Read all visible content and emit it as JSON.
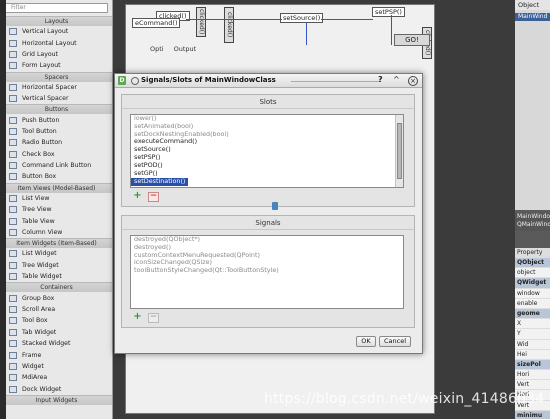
{
  "widget_box": {
    "filter_placeholder": "Filter",
    "sections": [
      {
        "category": "Layouts",
        "items": [
          "Vertical Layout",
          "Horizontal Layout",
          "Grid Layout",
          "Form Layout"
        ]
      },
      {
        "category": "Spacers",
        "items": [
          "Horizontal Spacer",
          "Vertical Spacer"
        ]
      },
      {
        "category": "Buttons",
        "items": [
          "Push Button",
          "Tool Button",
          "Radio Button",
          "Check Box",
          "Command Link Button",
          "Button Box"
        ]
      },
      {
        "category": "Item Views (Model-Based)",
        "items": [
          "List View",
          "Tree View",
          "Table View",
          "Column View"
        ]
      },
      {
        "category": "Item Widgets (Item-Based)",
        "items": [
          "List Widget",
          "Tree Widget",
          "Table Widget"
        ]
      },
      {
        "category": "Containers",
        "items": [
          "Group Box",
          "Scroll Area",
          "Tool Box",
          "Tab Widget",
          "Stacked Widget",
          "Frame",
          "Widget",
          "MdiArea",
          "Dock Widget"
        ]
      },
      {
        "category": "Input Widgets",
        "items": []
      }
    ]
  },
  "form": {
    "slot_labels": {
      "clicked_a": "clicked()",
      "set_command": "eCommand()",
      "set_source": "setSource()",
      "set_psp": "setPSP()",
      "clicked_b": "clicked()",
      "clicked_c": "clicked()",
      "clicked_d": "clicked()"
    },
    "go_button": "GO!",
    "tabs": [
      "Opti",
      "Output"
    ]
  },
  "object_inspector": {
    "header": "Object",
    "selected": "MainWind",
    "title_line1": "MainWindo",
    "title_line2": "QMainWind"
  },
  "property_editor": {
    "header": "Property",
    "rows": [
      "QObject",
      "object",
      "QWidget",
      "window",
      "enable",
      "geome",
      "X",
      "Y",
      "Wid",
      "Hei",
      "sizePol",
      "Hori",
      "Vert",
      "Hori",
      "Vert",
      "minimu"
    ]
  },
  "dialog": {
    "title": "Signals/Slots of MainWindowClass",
    "help": "?",
    "up_arrow": "^",
    "close": "×",
    "slots_title": "Slots",
    "slots": [
      {
        "text": "lower()",
        "style": "dim"
      },
      {
        "text": "setAnimated(bool)",
        "style": "dim"
      },
      {
        "text": "setDockNestingEnabled(bool)",
        "style": "dim"
      },
      {
        "text": "executeCommand()",
        "style": "normal"
      },
      {
        "text": "setSource()",
        "style": "normal"
      },
      {
        "text": "setPSP()",
        "style": "normal"
      },
      {
        "text": "setPOD()",
        "style": "normal"
      },
      {
        "text": "setGP()",
        "style": "normal"
      },
      {
        "text": "setDestination()",
        "style": "selected"
      }
    ],
    "signals_title": "Signals",
    "signals": [
      {
        "text": "destroyed(QObject*)",
        "style": "dim"
      },
      {
        "text": "destroyed()",
        "style": "dim"
      },
      {
        "text": "customContextMenuRequested(QPoint)",
        "style": "dim"
      },
      {
        "text": "iconSizeChanged(QSize)",
        "style": "dim"
      },
      {
        "text": "toolButtonStyleChanged(Qt::ToolButtonStyle)",
        "style": "dim"
      }
    ],
    "plus": "+",
    "minus": "−",
    "ok_label": "OK",
    "cancel_label": "Cancel"
  },
  "watermark": "https://blog.csdn.net/weixin_41486034",
  "colors": {
    "selection": "#2a4fa8",
    "connection_line": "#3355cc",
    "add_green": "#2f9a2f",
    "remove_red": "#c44444"
  }
}
